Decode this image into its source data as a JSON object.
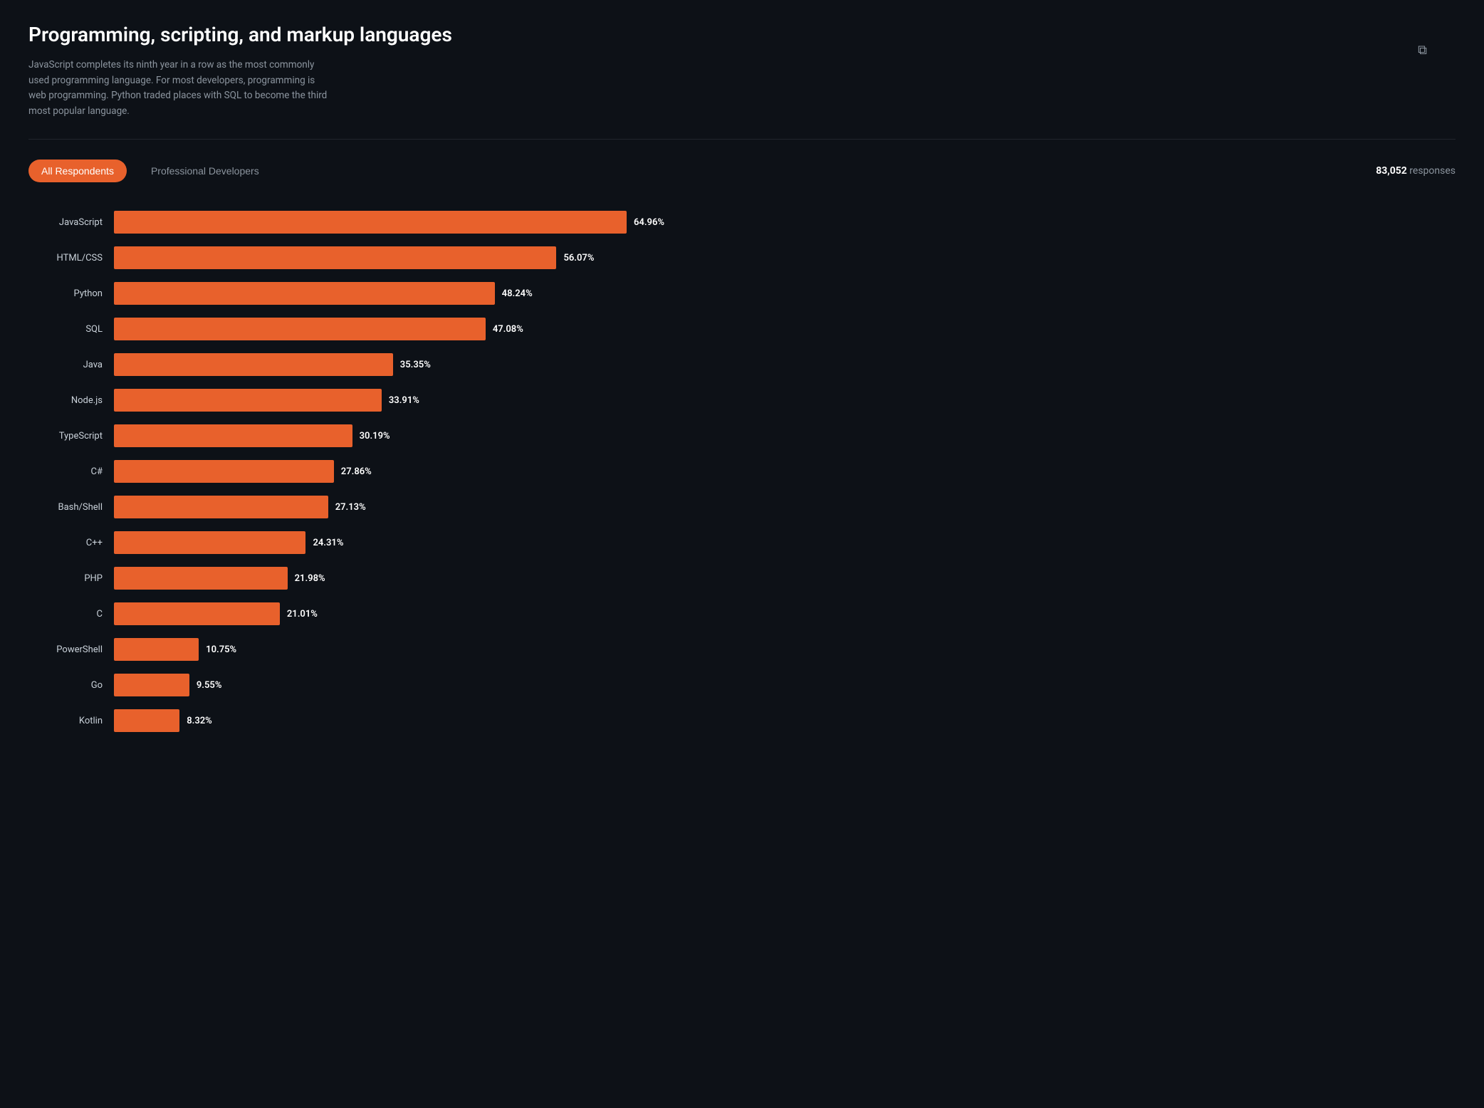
{
  "header": {
    "title": "Programming, scripting, and markup languages",
    "description": "JavaScript completes its ninth year in a row as the most commonly used programming language. For most developers, programming is web programming. Python traded places with SQL to become the third most popular language.",
    "link_icon": "🔗"
  },
  "filters": {
    "all_respondents_label": "All Respondents",
    "professional_developers_label": "Professional Developers",
    "responses_count": "83,052",
    "responses_label": "responses"
  },
  "chart": {
    "max_percent": 64.96,
    "bars": [
      {
        "label": "JavaScript",
        "value": 64.96,
        "display": "64.96%"
      },
      {
        "label": "HTML/CSS",
        "value": 56.07,
        "display": "56.07%"
      },
      {
        "label": "Python",
        "value": 48.24,
        "display": "48.24%"
      },
      {
        "label": "SQL",
        "value": 47.08,
        "display": "47.08%"
      },
      {
        "label": "Java",
        "value": 35.35,
        "display": "35.35%"
      },
      {
        "label": "Node.js",
        "value": 33.91,
        "display": "33.91%"
      },
      {
        "label": "TypeScript",
        "value": 30.19,
        "display": "30.19%"
      },
      {
        "label": "C#",
        "value": 27.86,
        "display": "27.86%"
      },
      {
        "label": "Bash/Shell",
        "value": 27.13,
        "display": "27.13%"
      },
      {
        "label": "C++",
        "value": 24.31,
        "display": "24.31%"
      },
      {
        "label": "PHP",
        "value": 21.98,
        "display": "21.98%"
      },
      {
        "label": "C",
        "value": 21.01,
        "display": "21.01%"
      },
      {
        "label": "PowerShell",
        "value": 10.75,
        "display": "10.75%"
      },
      {
        "label": "Go",
        "value": 9.55,
        "display": "9.55%"
      },
      {
        "label": "Kotlin",
        "value": 8.32,
        "display": "8.32%"
      }
    ]
  }
}
